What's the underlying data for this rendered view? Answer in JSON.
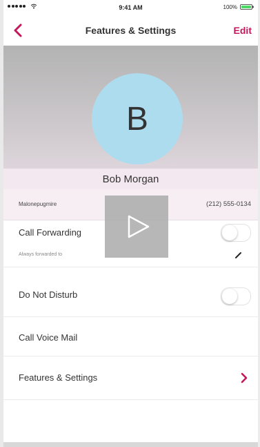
{
  "status_bar": {
    "time": "9:41 AM",
    "battery_text": "100%"
  },
  "nav": {
    "back_icon": "chevron-left-icon",
    "title": "Features & Settings",
    "edit_label": "Edit"
  },
  "contact": {
    "avatar_initial": "B",
    "avatar_color": "#aedcef",
    "name": "Bob Morgan",
    "username": "Malonepugmire",
    "phone": "(212) 555-0134"
  },
  "rows": {
    "call_forwarding": {
      "label": "Call Forwarding",
      "toggle_on": false,
      "sublabel": "Always forwarded to",
      "edit_icon": "pencil-icon"
    },
    "do_not_disturb": {
      "label": "Do Not Disturb",
      "toggle_on": false
    },
    "call_voice_mail": {
      "label": "Call Voice Mail"
    },
    "features_settings": {
      "label": "Features & Settings",
      "icon": "chevron-right-icon"
    }
  },
  "overlay": {
    "icon": "play-icon"
  },
  "colors": {
    "accent": "#c2185b",
    "battery": "#4cd964"
  }
}
